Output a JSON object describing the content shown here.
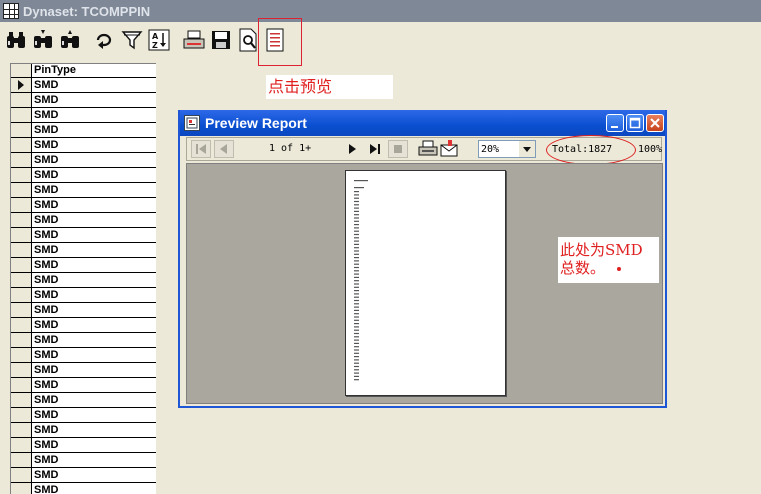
{
  "window": {
    "title": "Dynaset: TCOMPPIN"
  },
  "toolbar": {
    "buttons": [
      {
        "icon": "binoculars-find-icon"
      },
      {
        "icon": "binoculars-find-next-icon"
      },
      {
        "icon": "binoculars-find-prev-icon"
      },
      {
        "icon": "loop-icon"
      },
      {
        "icon": "filter-icon"
      },
      {
        "icon": "sort-az-icon"
      },
      {
        "icon": "print-icon"
      },
      {
        "icon": "save-icon"
      },
      {
        "icon": "preview-icon"
      },
      {
        "icon": "report-icon"
      }
    ]
  },
  "grid": {
    "column": "PinType",
    "rows": [
      "SMD",
      "SMD",
      "SMD",
      "SMD",
      "SMD",
      "SMD",
      "SMD",
      "SMD",
      "SMD",
      "SMD",
      "SMD",
      "SMD",
      "SMD",
      "SMD",
      "SMD",
      "SMD",
      "SMD",
      "SMD",
      "SMD",
      "SMD",
      "SMD",
      "SMD",
      "SMD",
      "SMD",
      "SMD",
      "SMD",
      "SMD",
      "SMD"
    ]
  },
  "annotations": {
    "preview_hint": "点击预览",
    "total_note_line1": "此处为SMD",
    "total_note_line2": "总数。"
  },
  "preview": {
    "title": "Preview Report",
    "page_indicator": "1 of 1+",
    "zoom": "20%",
    "total": "Total:1827",
    "percent": "100%"
  },
  "colors": {
    "annotation_red": "#e02020",
    "titlebar_blue": "#0a4fd0"
  }
}
